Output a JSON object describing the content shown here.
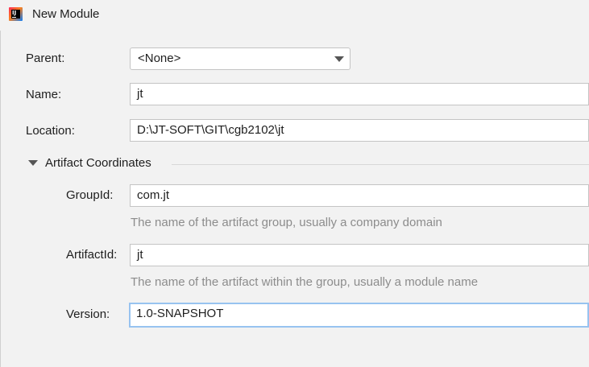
{
  "window": {
    "title": "New Module",
    "icon": "intellij-idea-icon"
  },
  "parent": {
    "label": "Parent:",
    "value": "<None>"
  },
  "name": {
    "label": "Name:",
    "value": "jt"
  },
  "location": {
    "label": "Location:",
    "value": "D:\\JT-SOFT\\GIT\\cgb2102\\jt"
  },
  "artifact": {
    "section_title": "Artifact Coordinates",
    "group_id": {
      "label": "GroupId:",
      "value": "com.jt",
      "hint": "The name of the artifact group, usually a company domain"
    },
    "artifact_id": {
      "label": "ArtifactId:",
      "value": "jt",
      "hint": "The name of the artifact within the group, usually a module name"
    },
    "version": {
      "label": "Version:",
      "value": "1.0-SNAPSHOT"
    }
  }
}
